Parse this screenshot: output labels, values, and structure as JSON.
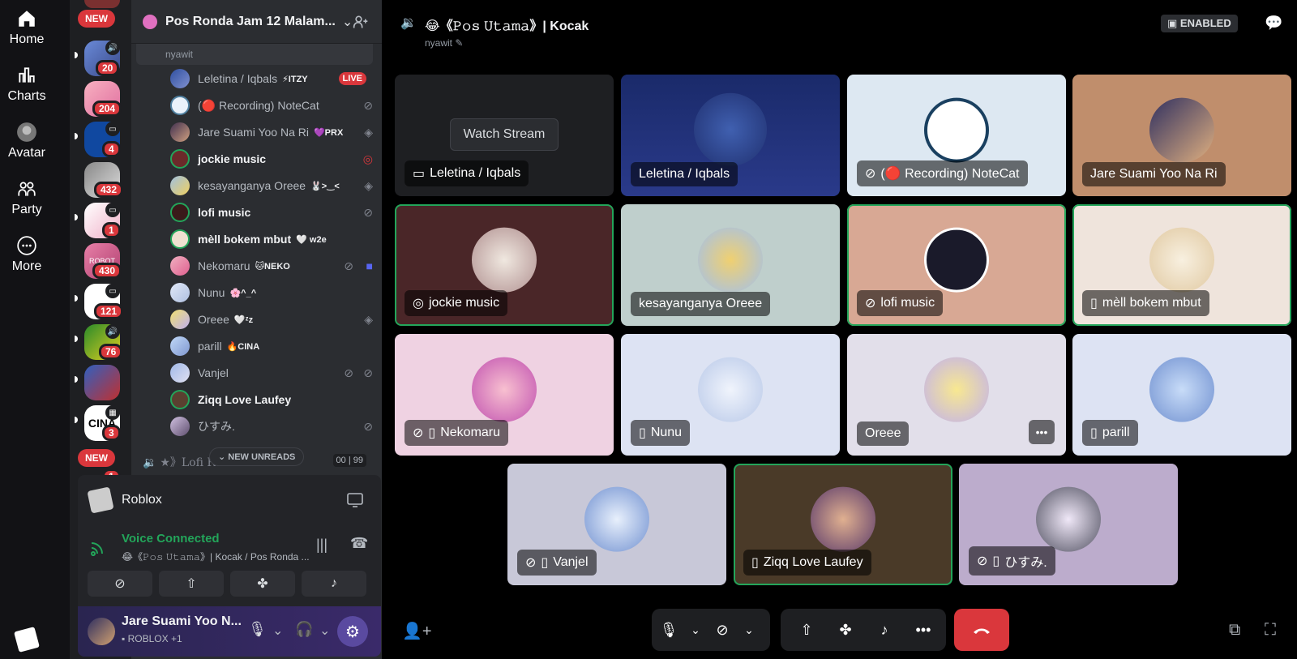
{
  "rail": {
    "items": [
      {
        "label": "Home",
        "icon": "home-icon"
      },
      {
        "label": "Charts",
        "icon": "charts-icon"
      },
      {
        "label": "Avatar",
        "icon": "avatar-icon"
      },
      {
        "label": "Party",
        "icon": "party-icon"
      },
      {
        "label": "More",
        "icon": "more-icon"
      }
    ]
  },
  "servers": {
    "new_top": "NEW",
    "new_bottom": "NEW",
    "badges": [
      "20",
      "204",
      "4",
      "432",
      "1",
      "430",
      "121",
      "76",
      "3",
      "1"
    ],
    "server_text": {
      "cina": "CINA",
      "roblox": "ROBOT"
    }
  },
  "guild": {
    "name": "Pos Ronda Jam 12 Malam..."
  },
  "channel": {
    "creator": "nyawit",
    "members": [
      {
        "name": "Leletina / Iqbals",
        "tag": "⚡ITZY",
        "bold": false,
        "live": "LIVE"
      },
      {
        "name": "(🔴 Recording) NoteCat",
        "tag": "",
        "bold": false
      },
      {
        "name": "Jare Suami Yoo Na Ri",
        "tag": "💜PRX",
        "bold": false
      },
      {
        "name": "jockie music",
        "tag": "",
        "bold": true
      },
      {
        "name": "kesayanganya Oreee",
        "tag": "🐰>‿<",
        "bold": false
      },
      {
        "name": "lofi music",
        "tag": "",
        "bold": true
      },
      {
        "name": "mèll bokem mbut",
        "tag": "🤍 w2e",
        "bold": true
      },
      {
        "name": "Nekomaru",
        "tag": "🐱NEKO",
        "bold": false
      },
      {
        "name": "Nunu",
        "tag": "🌸^_^",
        "bold": false
      },
      {
        "name": "Oreee",
        "tag": "🤍ᶻz",
        "bold": false
      },
      {
        "name": "parill",
        "tag": "🔥CINA",
        "bold": false
      },
      {
        "name": "Vanjel",
        "tag": "",
        "bold": false
      },
      {
        "name": "Ziqq Love Laufey",
        "tag": "",
        "bold": true
      },
      {
        "name": "ひすみ.",
        "tag": "",
        "bold": false
      }
    ],
    "next_channel": "★》Lofi Radio",
    "new_unreads": "NEW UNREADS",
    "count_a": "00",
    "count_b": "99"
  },
  "activity": {
    "name": "Roblox"
  },
  "voice": {
    "status": "Voice Connected",
    "channel": "😂《𝙿𝚘𝚜 𝚄𝚝𝚊𝚖𝚊》| Kocak / Pos Ronda ..."
  },
  "user": {
    "name": "Jare Suami Yoo N...",
    "status": "ROBLOX +1"
  },
  "header": {
    "title": "😂《𝙿𝚘𝚜 𝚄𝚝𝚊𝚖𝚊》| Kocak",
    "subtitle": "nyawit",
    "enabled": "ENABLED"
  },
  "tiles": [
    {
      "label": "Leletina / Iqbals",
      "stream": true,
      "watch": "Watch Stream"
    },
    {
      "label": "Leletina / Iqbals"
    },
    {
      "label": "(🔴 Recording) NoteCat"
    },
    {
      "label": "Jare Suami Yoo Na Ri"
    },
    {
      "label": "jockie music"
    },
    {
      "label": "kesayanganya Oreee"
    },
    {
      "label": "lofi music"
    },
    {
      "label": "mèll bokem mbut"
    },
    {
      "label": "Nekomaru"
    },
    {
      "label": "Nunu"
    },
    {
      "label": "Oreee"
    },
    {
      "label": "parill"
    },
    {
      "label": "Vanjel"
    },
    {
      "label": "Ziqq Love Laufey"
    },
    {
      "label": "ひすみ."
    }
  ],
  "colors": {
    "accent": "#5865f2",
    "green": "#23a55a",
    "red": "#da373c",
    "voice_green": "#23a55a"
  }
}
